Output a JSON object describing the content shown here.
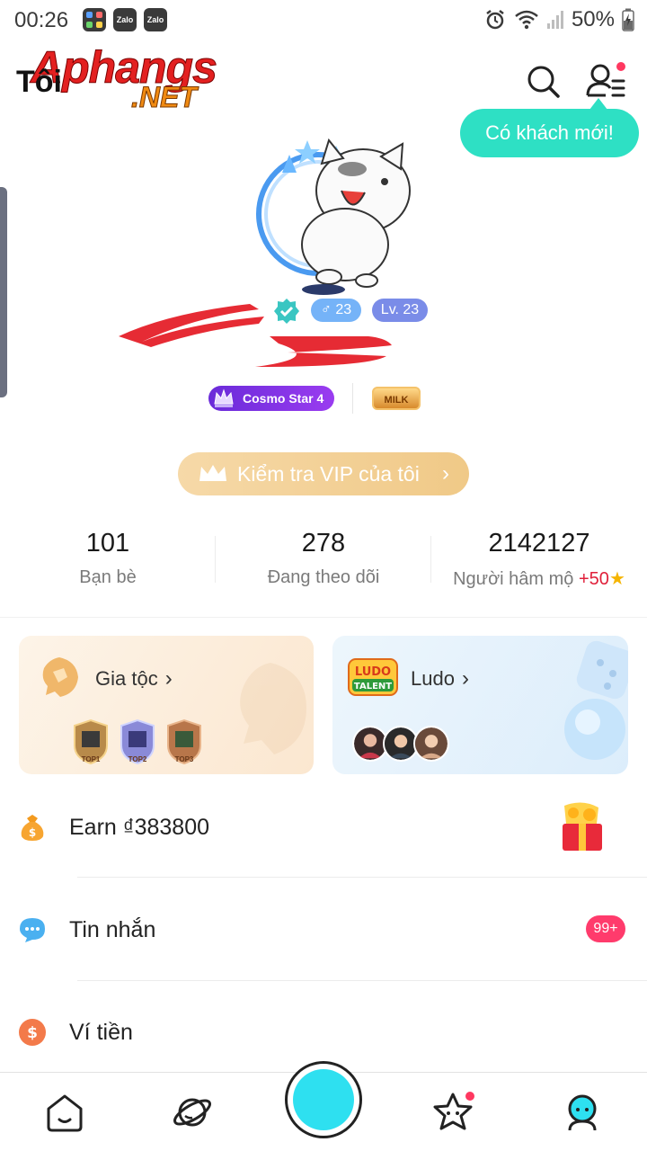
{
  "status_bar": {
    "time": "00:26",
    "notifications": [
      "app-folder-icon",
      "Zalo",
      "Zalo"
    ],
    "battery": "50%",
    "icons": [
      "alarm-icon",
      "wifi-icon",
      "signal-icon",
      "battery-charging-icon"
    ]
  },
  "header": {
    "title": "Tôi",
    "watermark_top": "Aphangs",
    "watermark_bottom": ".NET",
    "tooltip": "Có khách mới!"
  },
  "profile": {
    "gender_badge": "♂ 23",
    "level_badge": "Lv. 23",
    "cosmo_badge": "Cosmo Star 4",
    "milk_badge": "MILK"
  },
  "vip": {
    "label": "Kiểm tra VIP của tôi",
    "chevron": "›"
  },
  "stats": [
    {
      "value": "101",
      "label": "Bạn bè"
    },
    {
      "value": "278",
      "label": "Đang theo dõi"
    },
    {
      "value": "2142127",
      "label": "Người hâm mộ",
      "plus": "+50",
      "star": "★"
    }
  ],
  "cards": {
    "clan": {
      "title": "Gia tộc",
      "chevron": "›",
      "tops": [
        "TOP1",
        "TOP2",
        "TOP3"
      ]
    },
    "ludo": {
      "title": "Ludo",
      "chevron": "›",
      "logo_text": "LUDO TALENT"
    }
  },
  "menu": [
    {
      "label": "Earn ₫383800",
      "icon": "money-bag-icon"
    },
    {
      "label": "Tin nhắn",
      "icon": "chat-bubble-icon",
      "badge": "99+"
    },
    {
      "label": "Ví tiền",
      "icon": "wallet-dollar-icon"
    }
  ],
  "bottom_nav": [
    "home-icon",
    "planet-icon",
    "live-button",
    "star-face-icon",
    "profile-icon"
  ],
  "colors": {
    "accent": "#2ee0c4",
    "live": "#2ee0f0",
    "badge_red": "#ff3b6c",
    "vip_gold": "#f0c987"
  }
}
